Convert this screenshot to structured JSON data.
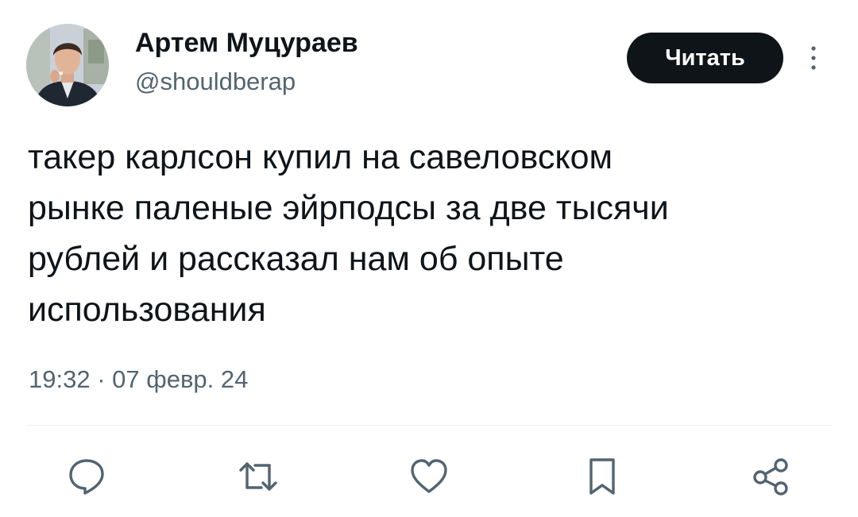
{
  "author": {
    "name": "Артем Муцураев",
    "handle": "@shouldberap"
  },
  "follow_button": {
    "label": "Читать"
  },
  "tweet": {
    "lines": [
      "такер карлсон купил на савеловском",
      "рынке паленые эйрподсы за две тысячи",
      "рублей и рассказал нам об опыте",
      "использования"
    ],
    "timestamp": "19:32 · 07 февр. 24"
  },
  "actions": {
    "icons": [
      "reply-icon",
      "retweet-icon",
      "like-icon",
      "bookmark-icon",
      "share-icon"
    ]
  },
  "colors": {
    "text": "#0f1419",
    "secondary_text": "#536471",
    "button_bg": "#0f1419",
    "button_text": "#ffffff",
    "divider": "#eff3f4"
  }
}
